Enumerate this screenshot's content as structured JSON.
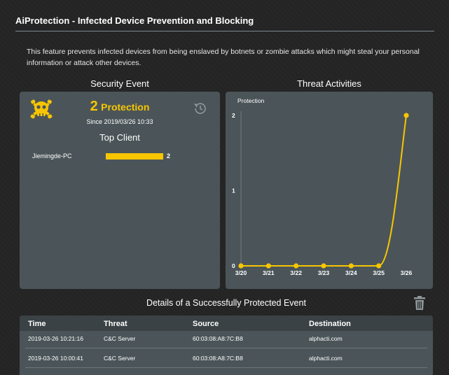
{
  "page": {
    "title": "AiProtection - Infected Device Prevention and Blocking",
    "description": "This feature prevents infected devices from being enslaved by botnets or zombie attacks which might steal your personal information or attack other devices."
  },
  "security_event": {
    "heading": "Security Event",
    "count": "2",
    "count_label": "Protection",
    "since": "Since 2019/03/26 10:33",
    "top_client_heading": "Top Client",
    "clients": [
      {
        "name": "Jiemingde-PC",
        "count": "2",
        "value": 2
      }
    ],
    "icons": {
      "skull": "skull-crossbones-icon",
      "reset": "reset-history-icon"
    },
    "accent_color": "#f7c600"
  },
  "threat_activities": {
    "heading": "Threat Activities",
    "chart_data": {
      "type": "line",
      "title": "",
      "ylabel": "Protection",
      "xlabel": "",
      "categories": [
        "3/20",
        "3/21",
        "3/22",
        "3/23",
        "3/24",
        "3/25",
        "3/26"
      ],
      "series": [
        {
          "values": [
            0,
            0,
            0,
            0,
            0,
            0,
            2
          ]
        }
      ],
      "ylim": [
        0,
        2
      ],
      "yticks": [
        "0",
        "1",
        "2"
      ],
      "grid": false,
      "line_color": "#f7c600"
    }
  },
  "details": {
    "heading": "Details of a Successfully Protected Event",
    "clear_icon": "trash-icon",
    "columns": [
      "Time",
      "Threat",
      "Source",
      "Destination"
    ],
    "rows": [
      [
        "2019-03-26 10:21:16",
        "C&C Server",
        "60:03:08:A8:7C:B8",
        "alphacti.com"
      ],
      [
        "2019-03-26 10:00:41",
        "C&C Server",
        "60:03:08:A8:7C:B8",
        "alphacti.com"
      ]
    ]
  }
}
